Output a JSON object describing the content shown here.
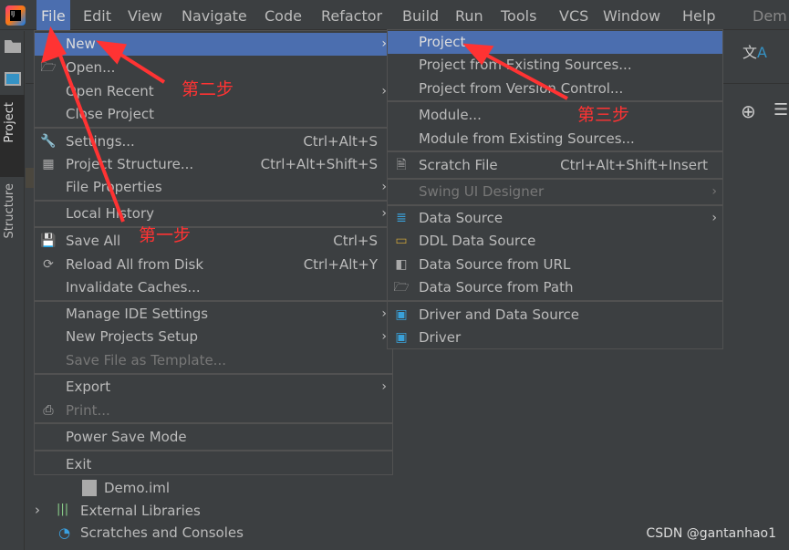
{
  "menubar": {
    "items": [
      "File",
      "Edit",
      "View",
      "Navigate",
      "Code",
      "Refactor",
      "Build",
      "Run",
      "Tools",
      "VCS",
      "Window",
      "Help"
    ],
    "title": "Dem",
    "active": "File"
  },
  "left_toolbar": {
    "project_tab": "Project",
    "structure_tab": "Structure"
  },
  "file_menu": [
    {
      "label": "New",
      "submenu": true,
      "selected": true
    },
    {
      "label": "Open...",
      "icon": "folder-icon"
    },
    {
      "label": "Open Recent",
      "submenu": true
    },
    {
      "label": "Close Project",
      "sep_after": true
    },
    {
      "label": "Settings...",
      "shortcut": "Ctrl+Alt+S",
      "icon": "wrench-icon"
    },
    {
      "label": "Project Structure...",
      "shortcut": "Ctrl+Alt+Shift+S",
      "icon": "project-structure-icon"
    },
    {
      "label": "File Properties",
      "submenu": true,
      "sep_after": true
    },
    {
      "label": "Local History",
      "submenu": true,
      "sep_after": true
    },
    {
      "label": "Save All",
      "shortcut": "Ctrl+S",
      "icon": "save-icon"
    },
    {
      "label": "Reload All from Disk",
      "shortcut": "Ctrl+Alt+Y",
      "icon": "reload-icon"
    },
    {
      "label": "Invalidate Caches...",
      "sep_after": true
    },
    {
      "label": "Manage IDE Settings",
      "submenu": true
    },
    {
      "label": "New Projects Setup",
      "submenu": true
    },
    {
      "label": "Save File as Template...",
      "disabled": true,
      "sep_after": true
    },
    {
      "label": "Export",
      "submenu": true
    },
    {
      "label": "Print...",
      "disabled": true,
      "icon": "print-icon",
      "sep_after": true
    },
    {
      "label": "Power Save Mode",
      "sep_after": true
    },
    {
      "label": "Exit"
    }
  ],
  "new_submenu": [
    {
      "label": "Project...",
      "selected": true
    },
    {
      "label": "Project from Existing Sources..."
    },
    {
      "label": "Project from Version Control...",
      "sep_after": true
    },
    {
      "label": "Module..."
    },
    {
      "label": "Module from Existing Sources...",
      "sep_after": true
    },
    {
      "label": "Scratch File",
      "shortcut": "Ctrl+Alt+Shift+Insert",
      "icon": "scratch-file-icon",
      "sep_after": true
    },
    {
      "label": "Swing UI Designer",
      "submenu": true,
      "disabled": true,
      "sep_after": true
    },
    {
      "label": "Data Source",
      "submenu": true,
      "icon": "database-icon"
    },
    {
      "label": "DDL Data Source",
      "icon": "ddl-icon"
    },
    {
      "label": "Data Source from URL",
      "icon": "plug-icon"
    },
    {
      "label": "Data Source from Path",
      "icon": "folder-icon",
      "sep_after": true
    },
    {
      "label": "Driver and Data Source",
      "icon": "driver-icon"
    },
    {
      "label": "Driver",
      "icon": "driver-icon"
    }
  ],
  "tree": {
    "items": [
      "Demo.iml",
      "External Libraries",
      "Scratches and Consoles"
    ]
  },
  "annotations": {
    "step1": "第一步",
    "step2": "第二步",
    "step3": "第三步"
  },
  "watermark": "CSDN @gantanhao1",
  "colors": {
    "selection": "#4b6eaf",
    "annotation": "#ff3333",
    "background": "#3c3f41"
  }
}
